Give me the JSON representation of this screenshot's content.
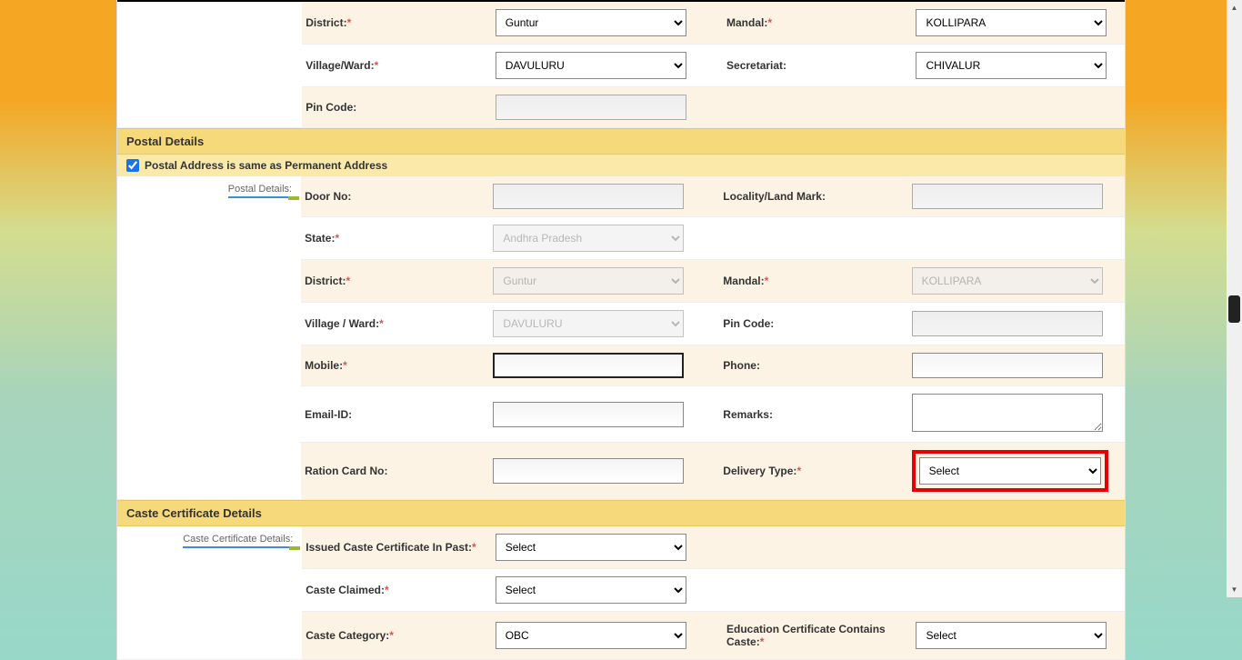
{
  "permanent": {
    "district_label": "District:",
    "district_value": "Guntur",
    "mandal_label": "Mandal:",
    "mandal_value": "KOLLIPARA",
    "village_label": "Village/Ward:",
    "village_value": "DAVULURU",
    "secretariat_label": "Secretariat:",
    "secretariat_value": "CHIVALUR",
    "pincode_label": "Pin Code:",
    "pincode_value": ""
  },
  "postal": {
    "section_title": "Postal Details",
    "same_as_label": "Postal Address is same as Permanent Address",
    "side_label": "Postal Details:",
    "door_label": "Door No:",
    "door_value": "",
    "locality_label": "Locality/Land Mark:",
    "locality_value": "",
    "state_label": "State:",
    "state_value": "Andhra Pradesh",
    "district_label": "District:",
    "district_value": "Guntur",
    "mandal_label": "Mandal:",
    "mandal_value": "KOLLIPARA",
    "village_label": "Village / Ward:",
    "village_value": "DAVULURU",
    "pincode_label": "Pin Code:",
    "pincode_value": "",
    "mobile_label": "Mobile:",
    "mobile_value": "",
    "phone_label": "Phone:",
    "phone_value": "",
    "email_label": "Email-ID:",
    "email_value": "",
    "remarks_label": "Remarks:",
    "remarks_value": "",
    "ration_label": "Ration Card No:",
    "ration_value": "",
    "delivery_label": "Delivery Type:",
    "delivery_value": "Select"
  },
  "caste": {
    "section_title": "Caste Certificate Details",
    "side_label": "Caste Certificate Details:",
    "issued_label": "Issued Caste Certificate In Past:",
    "issued_value": "Select",
    "claimed_label": "Caste Claimed:",
    "claimed_value": "Select",
    "category_label": "Caste Category:",
    "category_value": "OBC",
    "edu_cert_label": "Education Certificate Contains Caste:",
    "edu_cert_value": "Select"
  }
}
